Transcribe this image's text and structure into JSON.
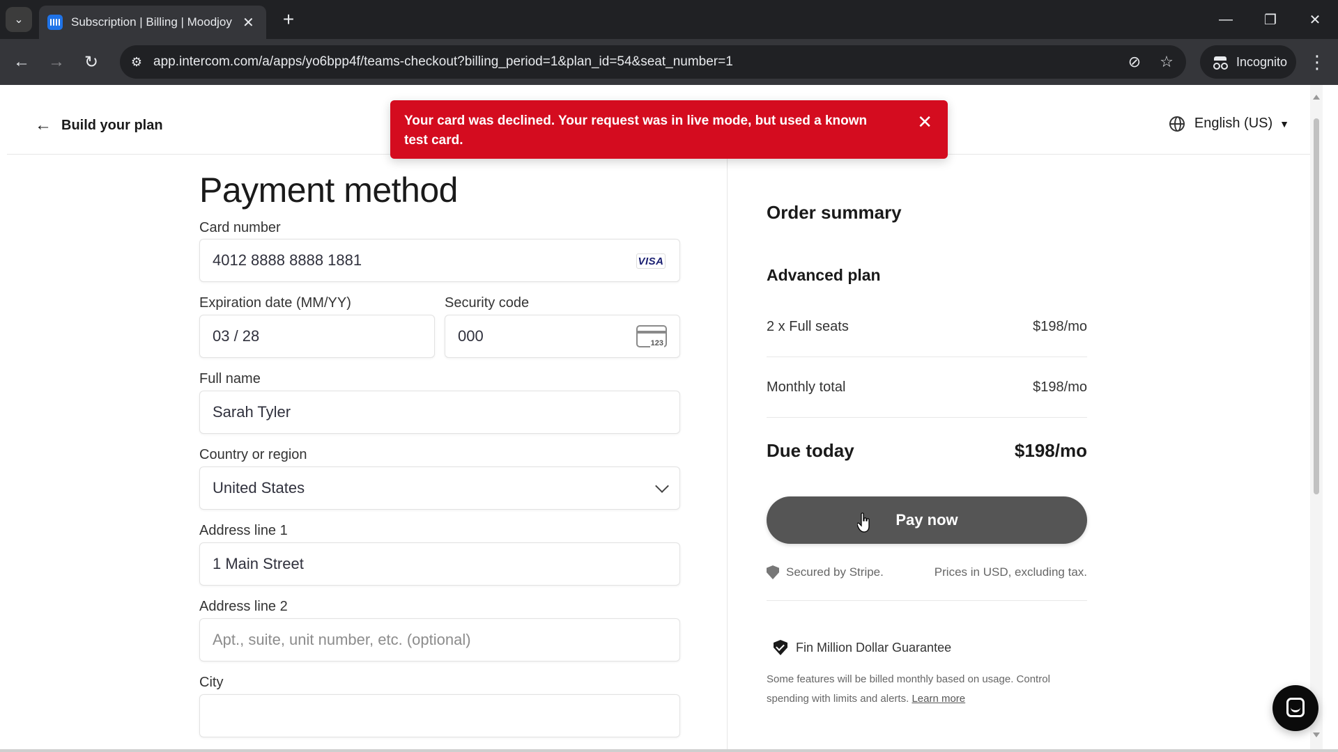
{
  "browser": {
    "tab_title": "Subscription | Billing | Moodjoy",
    "url": "app.intercom.com/a/apps/yo6bpp4f/teams-checkout?billing_period=1&plan_id=54&seat_number=1",
    "incognito_label": "Incognito",
    "icons": [
      "tab-search-icon",
      "new-tab-icon",
      "back-icon",
      "forward-icon",
      "reload-icon",
      "site-info-icon",
      "eye-off-icon",
      "star-icon",
      "menu-icon"
    ]
  },
  "header": {
    "back_label": "Build your plan",
    "language": "English (US)"
  },
  "error": {
    "message": "Your card was declined. Your request was in live mode, but used a known test card.",
    "color": "#d40c1f"
  },
  "form": {
    "title": "Payment method",
    "card_number_label": "Card number",
    "card_number_value": "4012 8888 8888 1881",
    "card_brand": "VISA",
    "expiry_label": "Expiration date (MM/YY)",
    "expiry_value": "03 / 28",
    "cvc_label": "Security code",
    "cvc_value": "000",
    "cvc_icon_text": "123",
    "name_label": "Full name",
    "name_value": "Sarah Tyler",
    "country_label": "Country or region",
    "country_value": "United States",
    "address1_label": "Address line 1",
    "address1_value": "1 Main Street",
    "address2_label": "Address line 2",
    "address2_placeholder": "Apt., suite, unit number, etc. (optional)",
    "city_label": "City"
  },
  "summary": {
    "title": "Order summary",
    "plan_name": "Advanced plan",
    "seats_label": "2 x Full seats",
    "seats_value": "$198/mo",
    "monthly_label": "Monthly total",
    "monthly_value": "$198/mo",
    "due_label": "Due today",
    "due_value": "$198/mo",
    "pay_button": "Pay now",
    "secured_text": "Secured by Stripe.",
    "prices_note": "Prices in USD, excluding tax.",
    "guarantee": "Fin Million Dollar Guarantee",
    "usage_note": "Some features will be billed monthly based on usage. Control spending with limits and alerts.",
    "learn_more": "Learn more"
  }
}
